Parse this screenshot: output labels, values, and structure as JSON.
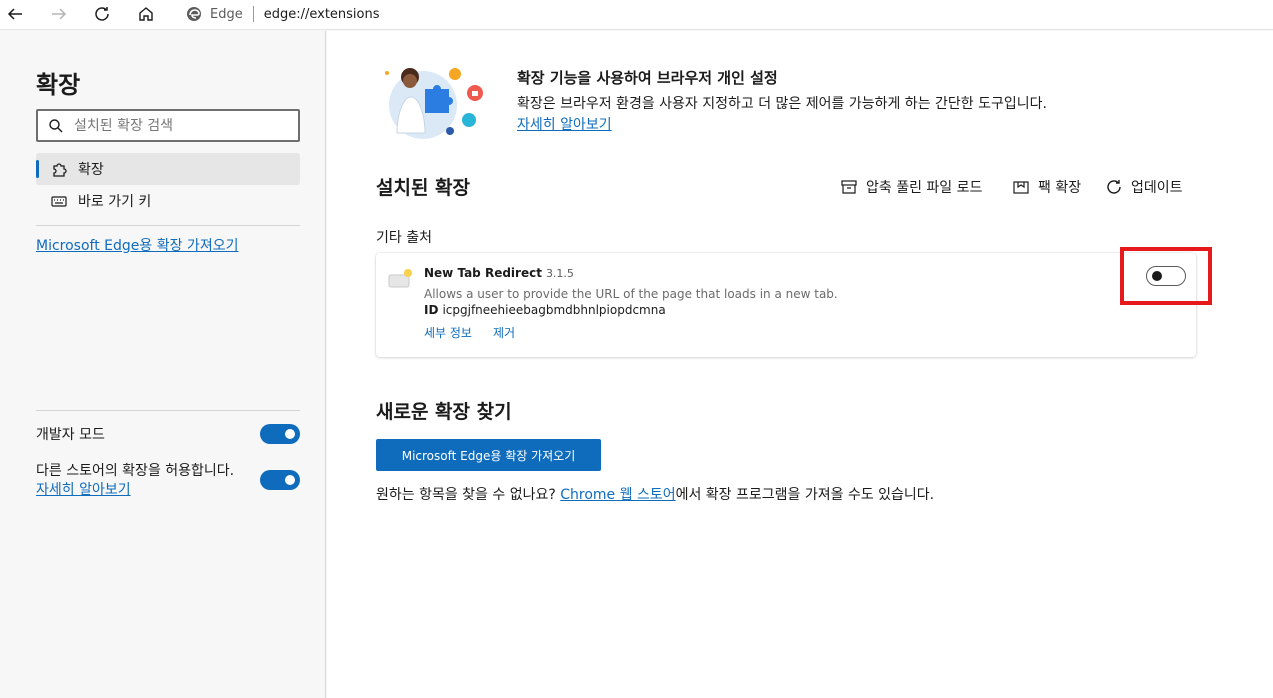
{
  "toolbar": {
    "site_label": "Edge",
    "url": "edge://extensions"
  },
  "sidebar": {
    "title": "확장",
    "search_placeholder": "설치된 확장 검색",
    "items": [
      {
        "label": "확장",
        "active": true
      },
      {
        "label": "바로 가기 키",
        "active": false
      }
    ],
    "store_link": "Microsoft Edge용 확장 가져오기",
    "dev_mode_label": "개발자 모드",
    "dev_mode_on": true,
    "other_store_label": "다른 스토어의 확장을 허용합니다.",
    "other_store_on": true,
    "learn_more": "자세히 알아보기"
  },
  "main": {
    "hero_title": "확장 기능을 사용하여 브라우저 개인 설정",
    "hero_desc": "확장은 브라우저 환경을 사용자 지정하고 더 많은 제어를 가능하게 하는 간단한 도구입니다.",
    "hero_link": "자세히 알아보기",
    "installed_title": "설치된 확장",
    "actions": {
      "load_unpacked": "압축 풀린 파일 로드",
      "pack": "팩 확장",
      "update": "업데이트"
    },
    "source_label": "기타 출처",
    "extension": {
      "name": "New Tab Redirect",
      "version": "3.1.5",
      "description": "Allows a user to provide the URL of the page that loads in a new tab.",
      "id_label": "ID",
      "id": "icpgjfneehieebagbmdbhnlpiopdcmna",
      "details_link": "세부 정보",
      "remove_link": "제거",
      "enabled": false
    },
    "find_title": "새로운 확장 찾기",
    "store_button": "Microsoft Edge용 확장 가져오기",
    "find_desc_before": "원하는 항목을 찾을 수 없나요?",
    "find_desc_link": "Chrome 웹 스토어",
    "find_desc_after": "에서 확장 프로그램을 가져올 수도 있습니다."
  },
  "colors": {
    "accent": "#0f6cbd",
    "highlight": "#e41a1c"
  }
}
